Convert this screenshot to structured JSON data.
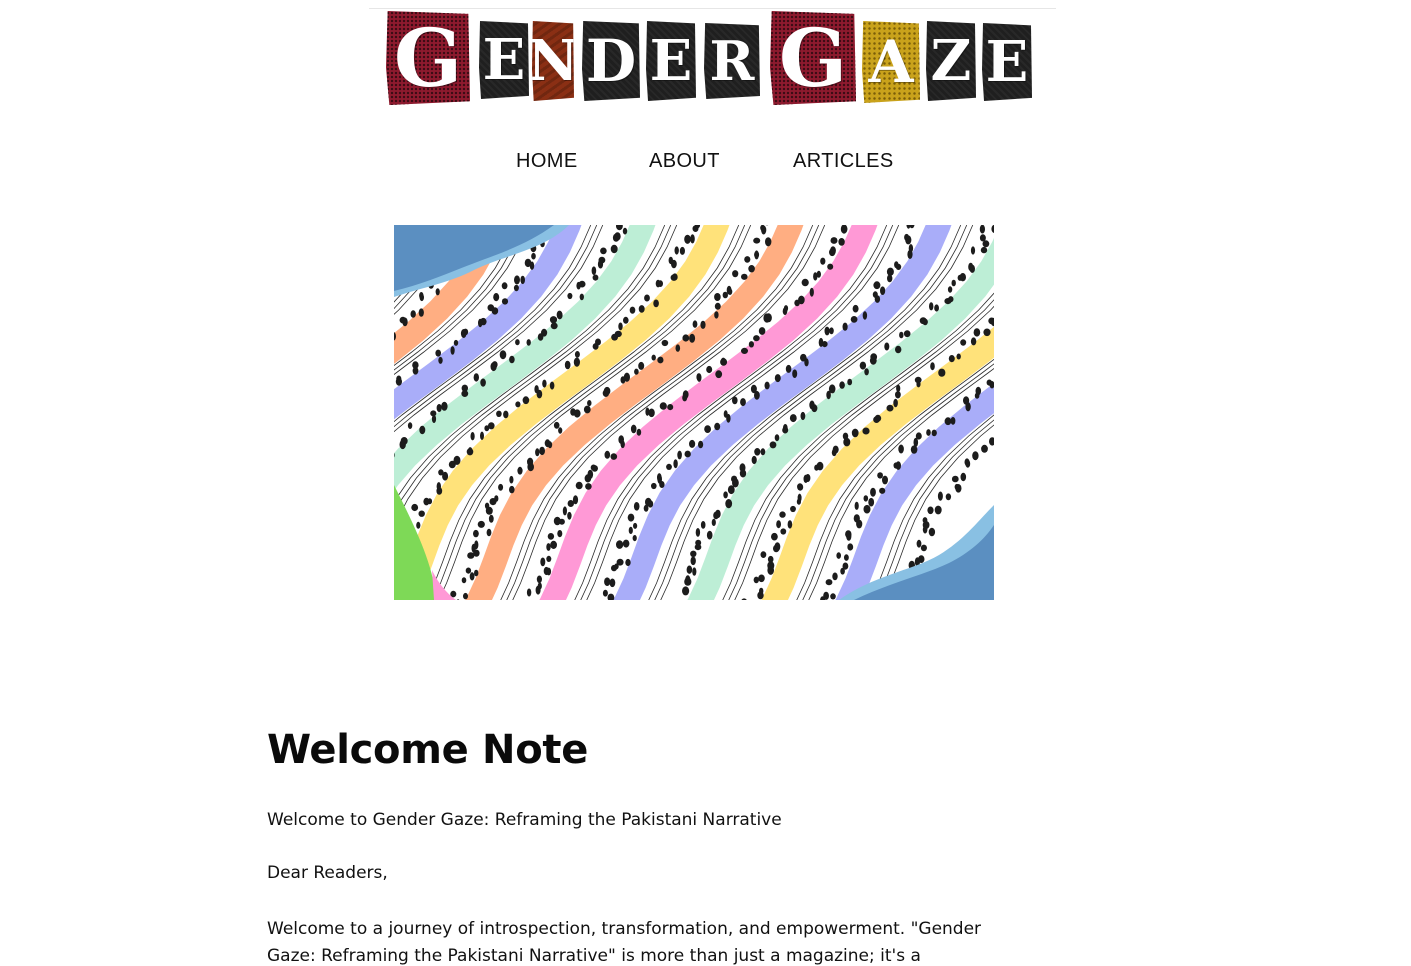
{
  "site": {
    "logo_text": [
      "G",
      "E",
      "N",
      "D",
      "E",
      "R",
      "G",
      "A",
      "Z",
      "E"
    ]
  },
  "nav": {
    "items": [
      {
        "label": "HOME"
      },
      {
        "label": "ABOUT"
      },
      {
        "label": "ARTICLES"
      }
    ]
  },
  "hero": {
    "colors": {
      "blue_corner": "#5b8fc1",
      "light_blue": "#89c0e3",
      "orange": "#ffae82",
      "yellow": "#ffe27a",
      "pink": "#ff99d6",
      "lavender": "#a9adf9",
      "mint": "#bdeed6",
      "green": "#7ed957",
      "dots": "#1c1c1c"
    }
  },
  "article": {
    "heading": "Welcome Note",
    "subtitle": "Welcome to Gender Gaze: Reframing the Pakistani Narrative",
    "greeting": "Dear Readers,",
    "body": "Welcome to a journey of introspection, transformation, and empowerment. \"Gender Gaze: Reframing the Pakistani Narrative\" is more than just a magazine; it's a"
  }
}
